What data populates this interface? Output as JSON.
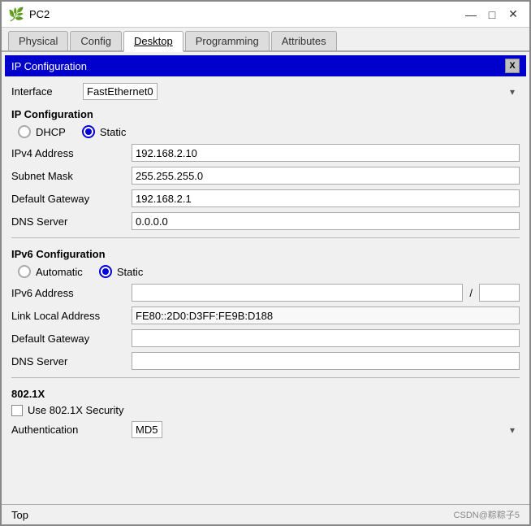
{
  "window": {
    "title": "PC2",
    "icon": "🌿"
  },
  "titlebar": {
    "minimize_label": "—",
    "maximize_label": "□",
    "close_label": "✕"
  },
  "tabs": [
    {
      "id": "physical",
      "label": "Physical",
      "active": false
    },
    {
      "id": "config",
      "label": "Config",
      "active": false
    },
    {
      "id": "desktop",
      "label": "Desktop",
      "active": true
    },
    {
      "id": "programming",
      "label": "Programming",
      "active": false
    },
    {
      "id": "attributes",
      "label": "Attributes",
      "active": false
    }
  ],
  "ip_config_header": "IP Configuration",
  "ip_config_close": "X",
  "interface": {
    "label": "Interface",
    "value": "FastEthernet0"
  },
  "ip_config_section": {
    "title": "IP Configuration",
    "dhcp_label": "DHCP",
    "static_label": "Static",
    "static_selected": true,
    "fields": [
      {
        "label": "IPv4 Address",
        "value": "192.168.2.10",
        "name": "ipv4-address"
      },
      {
        "label": "Subnet Mask",
        "value": "255.255.255.0",
        "name": "subnet-mask"
      },
      {
        "label": "Default Gateway",
        "value": "192.168.2.1",
        "name": "default-gateway"
      },
      {
        "label": "DNS Server",
        "value": "0.0.0.0",
        "name": "dns-server"
      }
    ]
  },
  "ipv6_config_section": {
    "title": "IPv6 Configuration",
    "automatic_label": "Automatic",
    "static_label": "Static",
    "static_selected": true,
    "ipv6_address_label": "IPv6 Address",
    "ipv6_address_value": "",
    "ipv6_prefix_value": "",
    "link_local_label": "Link Local Address",
    "link_local_value": "FE80::2D0:D3FF:FE9B:D188",
    "default_gateway_label": "Default Gateway",
    "default_gateway_value": "",
    "dns_server_label": "DNS Server",
    "dns_server_value": ""
  },
  "dot1x_section": {
    "title": "802.1X",
    "use_security_label": "Use 802.1X Security",
    "authentication_label": "Authentication",
    "authentication_value": "MD5"
  },
  "bottom_bar": {
    "top_label": "Top",
    "watermark": "CSDN@粽粽子5"
  }
}
